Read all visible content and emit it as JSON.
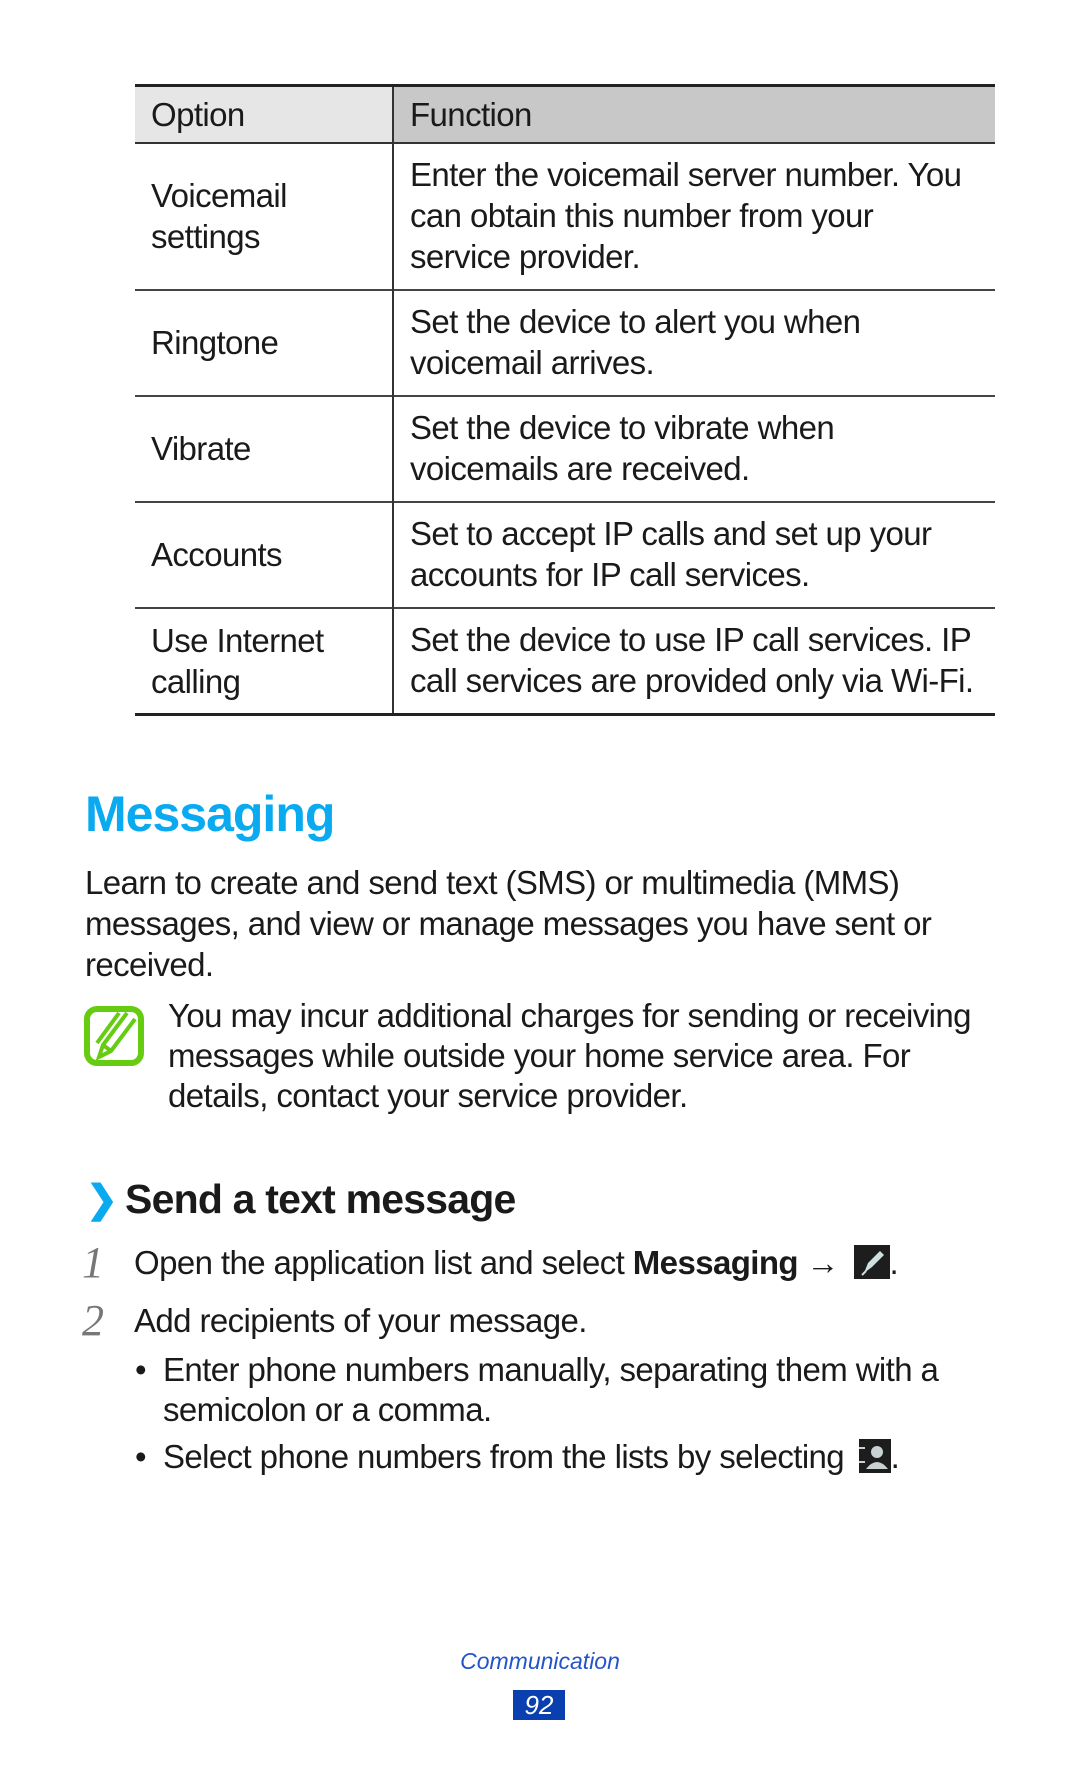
{
  "table": {
    "headers": [
      "Option",
      "Function"
    ],
    "rows": [
      {
        "option": "Voicemail settings",
        "function": "Enter the voicemail server number. You can obtain this number from your service provider."
      },
      {
        "option": "Ringtone",
        "function": "Set the device to alert you when voicemail arrives."
      },
      {
        "option": "Vibrate",
        "function": "Set the device to vibrate when voicemails are received."
      },
      {
        "option": "Accounts",
        "function": "Set to accept IP calls and set up your accounts for IP call services."
      },
      {
        "option": "Use Internet calling",
        "function": "Set the device to use IP call services. IP call services are provided only via Wi-Fi."
      }
    ]
  },
  "section": {
    "title": "Messaging",
    "intro": "Learn to create and send text (SMS) or multimedia (MMS) messages, and view or manage messages you have sent or received.",
    "note": {
      "icon": "note-pencil-icon",
      "text": "You may incur additional charges for sending or receiving messages while outside your home service area. For details, contact your service provider."
    }
  },
  "subsection": {
    "chevron": "❯",
    "title": "Send a text message",
    "steps": [
      {
        "num": "1",
        "text_before": "Open the application list and select ",
        "bold": "Messaging",
        "arrow": " → ",
        "icon": "compose-icon",
        "text_after": "."
      },
      {
        "num": "2",
        "text": "Add recipients of your message."
      }
    ],
    "bullets": [
      {
        "text": "Enter phone numbers manually, separating them with a semicolon or a comma."
      },
      {
        "text_before": "Select phone numbers from the lists by selecting ",
        "icon": "contacts-icon",
        "text_after": "."
      }
    ]
  },
  "footer": {
    "chapter": "Communication",
    "page": "92"
  },
  "colors": {
    "accent": "#0aaaf0",
    "note_green": "#66cc11",
    "footer_blue": "#0a3fb0"
  }
}
